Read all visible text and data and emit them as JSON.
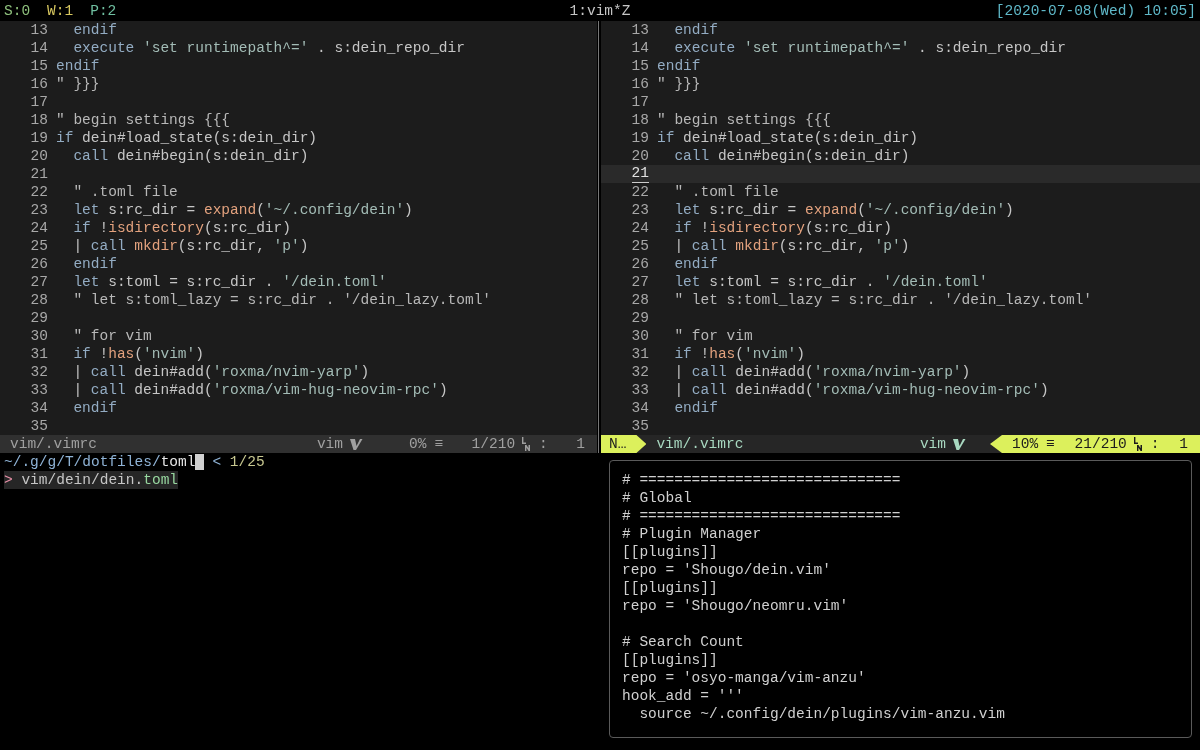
{
  "tmux_bar": {
    "sessions": [
      {
        "text": "S:0",
        "color": "#8ec07c"
      },
      {
        "text": "W:1",
        "color": "#d7c75f"
      },
      {
        "text": "P:2",
        "color": "#6fbfa0"
      }
    ],
    "window": "1:vim*Z",
    "clock": "[2020-07-08(Wed) 10:05]"
  },
  "panes": [
    {
      "active": false,
      "lines": [
        {
          "number": "13",
          "current": false,
          "segments": [
            {
              "text": "  endif",
              "kind": "keyword"
            }
          ]
        },
        {
          "number": "14",
          "current": false,
          "segments": [
            {
              "text": "  execute ",
              "kind": "keyword"
            },
            {
              "text": "'set runtimepath^='",
              "kind": "string"
            },
            {
              "text": " . s:dein_repo_dir",
              "kind": "plain"
            }
          ]
        },
        {
          "number": "15",
          "current": false,
          "segments": [
            {
              "text": "endif",
              "kind": "keyword"
            }
          ]
        },
        {
          "number": "16",
          "current": false,
          "segments": [
            {
              "text": "\" }}}",
              "kind": "comment"
            }
          ]
        },
        {
          "number": "17",
          "current": false
        },
        {
          "number": "18",
          "current": false,
          "segments": [
            {
              "text": "\" begin settings {{{",
              "kind": "comment"
            }
          ]
        },
        {
          "number": "19",
          "current": false,
          "segments": [
            {
              "text": "if",
              "kind": "keyword"
            },
            {
              "text": " dein#load_state(s:dein_dir)",
              "kind": "plain"
            }
          ]
        },
        {
          "number": "20",
          "current": false,
          "segments": [
            {
              "text": "  call",
              "kind": "keyword"
            },
            {
              "text": " dein#begin(s:dein_dir)",
              "kind": "plain"
            }
          ]
        },
        {
          "number": "21",
          "current": false
        },
        {
          "number": "22",
          "current": false,
          "segments": [
            {
              "text": "  \" .toml file",
              "kind": "comment"
            }
          ]
        },
        {
          "number": "23",
          "current": false,
          "segments": [
            {
              "text": "  let",
              "kind": "keyword"
            },
            {
              "text": " s:rc_dir = ",
              "kind": "plain"
            },
            {
              "text": "expand",
              "kind": "function"
            },
            {
              "text": "(",
              "kind": "plain"
            },
            {
              "text": "'~/.config/dein'",
              "kind": "string"
            },
            {
              "text": ")",
              "kind": "plain"
            }
          ]
        },
        {
          "number": "24",
          "current": false,
          "segments": [
            {
              "text": "  if",
              "kind": "keyword"
            },
            {
              "text": " !",
              "kind": "plain"
            },
            {
              "text": "isdirectory",
              "kind": "function"
            },
            {
              "text": "(s:rc_dir)",
              "kind": "plain"
            }
          ]
        },
        {
          "number": "25",
          "current": false,
          "segments": [
            {
              "text": "  | ",
              "kind": "plain"
            },
            {
              "text": "call ",
              "kind": "keyword"
            },
            {
              "text": "mkdir",
              "kind": "function"
            },
            {
              "text": "(s:rc_dir, ",
              "kind": "plain"
            },
            {
              "text": "'p'",
              "kind": "string"
            },
            {
              "text": ")",
              "kind": "plain"
            }
          ]
        },
        {
          "number": "26",
          "current": false,
          "segments": [
            {
              "text": "  endif",
              "kind": "keyword"
            }
          ]
        },
        {
          "number": "27",
          "current": false,
          "segments": [
            {
              "text": "  let",
              "kind": "keyword"
            },
            {
              "text": " s:toml = s:rc_dir . ",
              "kind": "plain"
            },
            {
              "text": "'/dein.toml'",
              "kind": "string"
            }
          ]
        },
        {
          "number": "28",
          "current": false,
          "segments": [
            {
              "text": "  \" let s:toml_lazy = s:rc_dir . '/dein_lazy.toml'",
              "kind": "comment"
            }
          ]
        },
        {
          "number": "29",
          "current": false
        },
        {
          "number": "30",
          "current": false,
          "segments": [
            {
              "text": "  \" for vim",
              "kind": "comment"
            }
          ]
        },
        {
          "number": "31",
          "current": false,
          "segments": [
            {
              "text": "  if",
              "kind": "keyword"
            },
            {
              "text": " !",
              "kind": "plain"
            },
            {
              "text": "has",
              "kind": "function"
            },
            {
              "text": "(",
              "kind": "plain"
            },
            {
              "text": "'nvim'",
              "kind": "string"
            },
            {
              "text": ")",
              "kind": "plain"
            }
          ]
        },
        {
          "number": "32",
          "current": false,
          "segments": [
            {
              "text": "  | ",
              "kind": "plain"
            },
            {
              "text": "call",
              "kind": "keyword"
            },
            {
              "text": " dein#add(",
              "kind": "plain"
            },
            {
              "text": "'roxma/nvim-yarp'",
              "kind": "string"
            },
            {
              "text": ")",
              "kind": "plain"
            }
          ]
        },
        {
          "number": "33",
          "current": false,
          "segments": [
            {
              "text": "  | ",
              "kind": "plain"
            },
            {
              "text": "call",
              "kind": "keyword"
            },
            {
              "text": " dein#add(",
              "kind": "plain"
            },
            {
              "text": "'roxma/vim-hug-neovim-rpc'",
              "kind": "string"
            },
            {
              "text": ")",
              "kind": "plain"
            }
          ]
        },
        {
          "number": "34",
          "current": false,
          "segments": [
            {
              "text": "  endif",
              "kind": "keyword"
            }
          ]
        },
        {
          "number": "35",
          "current": false
        }
      ],
      "status": {
        "file": "vim/.vimrc",
        "filetype": "vim",
        "percent": "0%",
        "menu": "≡",
        "position": "1/210",
        "separator": ":",
        "column": "1"
      }
    },
    {
      "active": true,
      "lines": [
        {
          "number": "13",
          "current": false,
          "segments": [
            {
              "text": "  endif",
              "kind": "keyword"
            }
          ]
        },
        {
          "number": "14",
          "current": false,
          "segments": [
            {
              "text": "  execute ",
              "kind": "keyword"
            },
            {
              "text": "'set runtimepath^='",
              "kind": "string"
            },
            {
              "text": " . s:dein_repo_dir",
              "kind": "plain"
            }
          ]
        },
        {
          "number": "15",
          "current": false,
          "segments": [
            {
              "text": "endif",
              "kind": "keyword"
            }
          ]
        },
        {
          "number": "16",
          "current": false,
          "segments": [
            {
              "text": "\" }}}",
              "kind": "comment"
            }
          ]
        },
        {
          "number": "17",
          "current": false
        },
        {
          "number": "18",
          "current": false,
          "segments": [
            {
              "text": "\" begin settings {{{",
              "kind": "comment"
            }
          ]
        },
        {
          "number": "19",
          "current": false,
          "segments": [
            {
              "text": "if",
              "kind": "keyword"
            },
            {
              "text": " dein#load_state(s:dein_dir)",
              "kind": "plain"
            }
          ]
        },
        {
          "number": "20",
          "current": false,
          "segments": [
            {
              "text": "  call",
              "kind": "keyword"
            },
            {
              "text": " dein#begin(s:dein_dir)",
              "kind": "plain"
            }
          ]
        },
        {
          "number": "21",
          "current": true
        },
        {
          "number": "22",
          "current": false,
          "segments": [
            {
              "text": "  \" .toml file",
              "kind": "comment"
            }
          ]
        },
        {
          "number": "23",
          "current": false,
          "segments": [
            {
              "text": "  let",
              "kind": "keyword"
            },
            {
              "text": " s:rc_dir = ",
              "kind": "plain"
            },
            {
              "text": "expand",
              "kind": "function"
            },
            {
              "text": "(",
              "kind": "plain"
            },
            {
              "text": "'~/.config/dein'",
              "kind": "string"
            },
            {
              "text": ")",
              "kind": "plain"
            }
          ]
        },
        {
          "number": "24",
          "current": false,
          "segments": [
            {
              "text": "  if",
              "kind": "keyword"
            },
            {
              "text": " !",
              "kind": "plain"
            },
            {
              "text": "isdirectory",
              "kind": "function"
            },
            {
              "text": "(s:rc_dir)",
              "kind": "plain"
            }
          ]
        },
        {
          "number": "25",
          "current": false,
          "segments": [
            {
              "text": "  | ",
              "kind": "plain"
            },
            {
              "text": "call ",
              "kind": "keyword"
            },
            {
              "text": "mkdir",
              "kind": "function"
            },
            {
              "text": "(s:rc_dir, ",
              "kind": "plain"
            },
            {
              "text": "'p'",
              "kind": "string"
            },
            {
              "text": ")",
              "kind": "plain"
            }
          ]
        },
        {
          "number": "26",
          "current": false,
          "segments": [
            {
              "text": "  endif",
              "kind": "keyword"
            }
          ]
        },
        {
          "number": "27",
          "current": false,
          "segments": [
            {
              "text": "  let",
              "kind": "keyword"
            },
            {
              "text": " s:toml = s:rc_dir . ",
              "kind": "plain"
            },
            {
              "text": "'/dein.toml'",
              "kind": "string"
            }
          ]
        },
        {
          "number": "28",
          "current": false,
          "segments": [
            {
              "text": "  \" let s:toml_lazy = s:rc_dir . '/dein_lazy.toml'",
              "kind": "comment"
            }
          ]
        },
        {
          "number": "29",
          "current": false
        },
        {
          "number": "30",
          "current": false,
          "segments": [
            {
              "text": "  \" for vim",
              "kind": "comment"
            }
          ]
        },
        {
          "number": "31",
          "current": false,
          "segments": [
            {
              "text": "  if",
              "kind": "keyword"
            },
            {
              "text": " !",
              "kind": "plain"
            },
            {
              "text": "has",
              "kind": "function"
            },
            {
              "text": "(",
              "kind": "plain"
            },
            {
              "text": "'nvim'",
              "kind": "string"
            },
            {
              "text": ")",
              "kind": "plain"
            }
          ]
        },
        {
          "number": "32",
          "current": false,
          "segments": [
            {
              "text": "  | ",
              "kind": "plain"
            },
            {
              "text": "call",
              "kind": "keyword"
            },
            {
              "text": " dein#add(",
              "kind": "plain"
            },
            {
              "text": "'roxma/nvim-yarp'",
              "kind": "string"
            },
            {
              "text": ")",
              "kind": "plain"
            }
          ]
        },
        {
          "number": "33",
          "current": false,
          "segments": [
            {
              "text": "  | ",
              "kind": "plain"
            },
            {
              "text": "call",
              "kind": "keyword"
            },
            {
              "text": " dein#add(",
              "kind": "plain"
            },
            {
              "text": "'roxma/vim-hug-neovim-rpc'",
              "kind": "string"
            },
            {
              "text": ")",
              "kind": "plain"
            }
          ]
        },
        {
          "number": "34",
          "current": false,
          "segments": [
            {
              "text": "  endif",
              "kind": "keyword"
            }
          ]
        },
        {
          "number": "35",
          "current": false
        }
      ],
      "status": {
        "mode": "N…",
        "file": "vim/.vimrc",
        "filetype": "vim",
        "percent": "10%",
        "menu": "≡",
        "position": "21/210",
        "separator": ":",
        "column": "1"
      }
    }
  ],
  "finder": {
    "path": "~/.g/g/T/dotfiles/",
    "query": "toml",
    "indicator": "<",
    "count": "1/25",
    "results": [
      {
        "marker": ">",
        "text": "vim/dein/dein.",
        "match": "toml",
        "selected": true
      }
    ]
  },
  "preview": {
    "blocks": [
      [
        "# ==============================",
        "# Global",
        "# ==============================",
        "# Plugin Manager",
        "[[plugins]]",
        "repo = 'Shougo/dein.vim'",
        "[[plugins]]",
        "repo = 'Shougo/neomru.vim'"
      ],
      [
        "# Search Count",
        "[[plugins]]",
        "repo = 'osyo-manga/vim-anzu'",
        "hook_add = '''",
        "  source ~/.config/dein/plugins/vim-anzu.vim"
      ]
    ]
  }
}
